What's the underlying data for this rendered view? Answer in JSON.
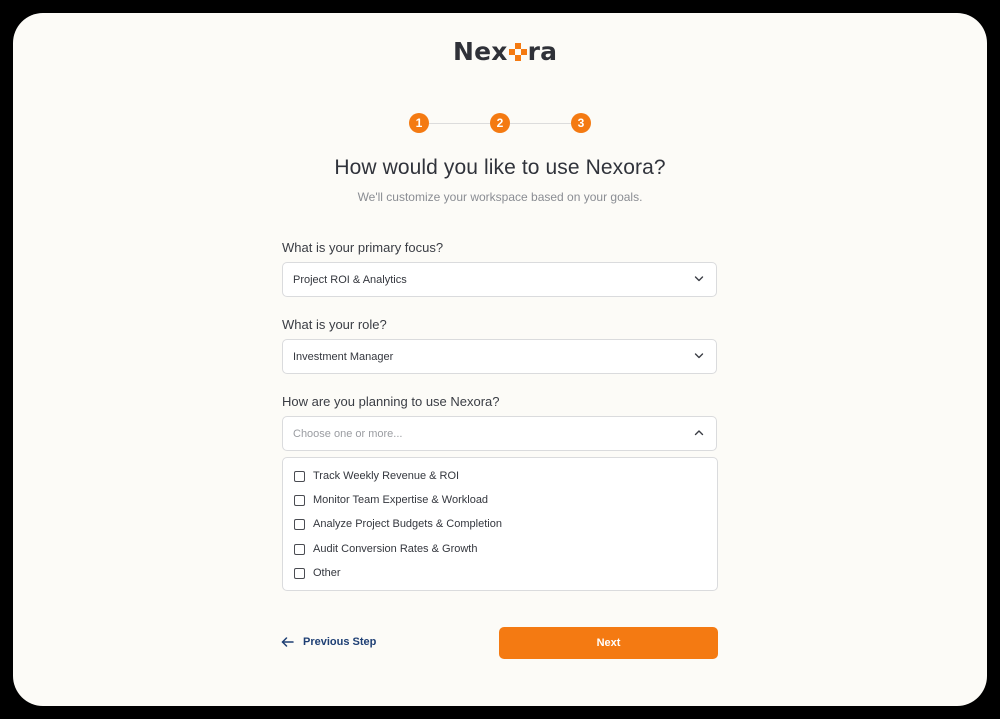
{
  "brand": {
    "name_prefix": "Nex",
    "name_suffix": "ra",
    "accent_color": "#f47a12"
  },
  "stepper": {
    "steps": [
      "1",
      "2",
      "3"
    ]
  },
  "header": {
    "title": "How would you like to use Nexora?",
    "subtitle": "We'll customize your workspace based on your goals."
  },
  "form": {
    "primary_focus": {
      "label": "What is your primary focus?",
      "value": "Project ROI & Analytics",
      "icon": "chevron-down-icon"
    },
    "role": {
      "label": "What is your role?",
      "value": "Investment Manager",
      "icon": "chevron-down-icon"
    },
    "usage": {
      "label": "How are you planning to use Nexora?",
      "placeholder": "Choose one or more...",
      "icon": "chevron-up-icon",
      "options": [
        "Track Weekly Revenue & ROI",
        "Monitor Team Expertise & Workload",
        "Analyze Project Budgets & Completion",
        "Audit Conversion Rates & Growth",
        "Other"
      ]
    }
  },
  "footer": {
    "back_label": "Previous Step",
    "back_icon": "arrow-left-icon",
    "next_label": "Next"
  }
}
